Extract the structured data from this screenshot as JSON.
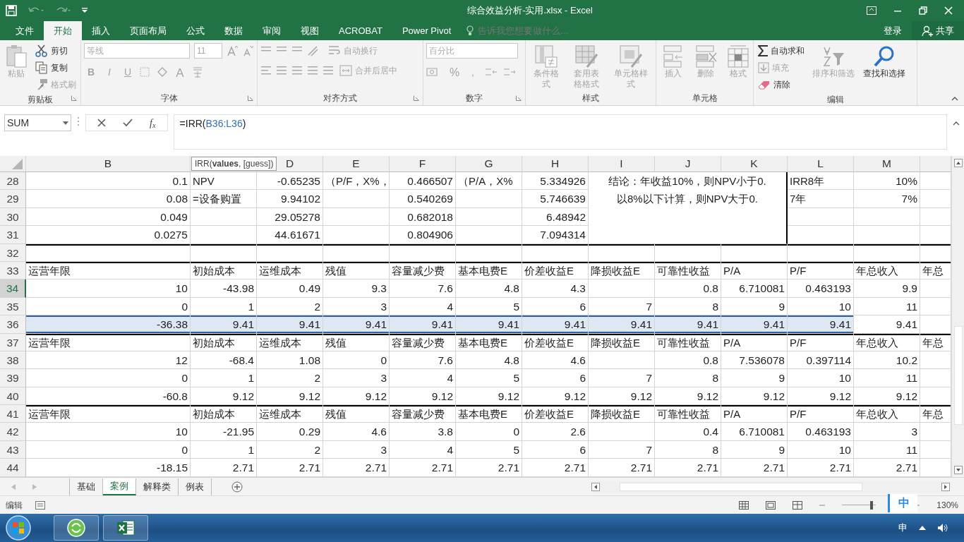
{
  "window": {
    "title": "综合效益分析-实用.xlsx - Excel"
  },
  "ribbon_tabs": [
    {
      "label": "文件",
      "selected": false
    },
    {
      "label": "开始",
      "selected": true
    },
    {
      "label": "插入",
      "selected": false
    },
    {
      "label": "页面布局",
      "selected": false
    },
    {
      "label": "公式",
      "selected": false
    },
    {
      "label": "数据",
      "selected": false
    },
    {
      "label": "审阅",
      "selected": false
    },
    {
      "label": "视图",
      "selected": false
    },
    {
      "label": "ACROBAT",
      "selected": false
    },
    {
      "label": "Power Pivot",
      "selected": false
    }
  ],
  "tell_me": {
    "placeholder": "告诉我您想要做什么..."
  },
  "account": {
    "sign_in": "登录",
    "share": "共享"
  },
  "ribbon_groups": [
    {
      "label": "剪贴板",
      "items": [
        {
          "kind": "large",
          "label": "粘贴",
          "disabled": true
        },
        {
          "kind": "small",
          "label": "剪切",
          "disabled": false
        },
        {
          "kind": "small",
          "label": "复制",
          "disabled": false
        },
        {
          "kind": "small",
          "label": "格式刷",
          "disabled": true
        }
      ]
    },
    {
      "label": "字体",
      "items": [
        {
          "kind": "field",
          "value": "等线",
          "disabled": true
        },
        {
          "kind": "field",
          "value": "11",
          "disabled": true
        },
        {
          "kind": "glyph",
          "label": "B",
          "disabled": true
        },
        {
          "kind": "glyph",
          "label": "I",
          "disabled": true
        },
        {
          "kind": "glyph",
          "label": "U",
          "disabled": true
        },
        {
          "kind": "glyph",
          "label": "A",
          "disabled": true
        }
      ]
    },
    {
      "label": "对齐方式",
      "items": [
        {
          "kind": "small",
          "label": "自动换行",
          "disabled": true
        },
        {
          "kind": "small",
          "label": "合并后居中",
          "disabled": true
        }
      ]
    },
    {
      "label": "数字",
      "items": [
        {
          "kind": "field",
          "value": "百分比",
          "disabled": true
        },
        {
          "kind": "glyph",
          "label": "%",
          "disabled": true
        },
        {
          "kind": "glyph",
          "label": ",",
          "disabled": true
        }
      ]
    },
    {
      "label": "样式",
      "items": [
        {
          "kind": "large",
          "label": "条件格式",
          "disabled": true
        },
        {
          "kind": "large",
          "label": "套用表格格式",
          "disabled": true
        },
        {
          "kind": "large",
          "label": "单元格样式",
          "disabled": true
        }
      ]
    },
    {
      "label": "单元格",
      "items": [
        {
          "kind": "large",
          "label": "插入",
          "disabled": true
        },
        {
          "kind": "large",
          "label": "删除",
          "disabled": true
        },
        {
          "kind": "large",
          "label": "格式",
          "disabled": true
        }
      ]
    },
    {
      "label": "编辑",
      "items": [
        {
          "kind": "small",
          "label": "自动求和",
          "disabled": false
        },
        {
          "kind": "small",
          "label": "填充",
          "disabled": true
        },
        {
          "kind": "small",
          "label": "清除",
          "disabled": false
        },
        {
          "kind": "large",
          "label": "排序和筛选",
          "disabled": true
        },
        {
          "kind": "large",
          "label": "查找和选择",
          "disabled": false
        }
      ]
    }
  ],
  "formula_bar": {
    "name_box": "SUM",
    "insert_function": "f$_{x}$",
    "formula": [
      {
        "kind": "plain",
        "text": "=IRR("
      },
      {
        "kind": "ref",
        "text": "B36:L36"
      },
      {
        "kind": "plain",
        "text": ")"
      }
    ],
    "tooltip": "IRR(**values**, [guess])"
  },
  "column_headers": [
    "B",
    "D",
    "E",
    "F",
    "G",
    "H",
    "I",
    "J",
    "K",
    "L",
    "M"
  ],
  "note": {
    "lines": [
      "结论：年收益10%，则NPV小于0.",
      "以8%以下计算，则NPV大于0."
    ]
  },
  "rows": [
    {
      "num": "28",
      "active": false,
      "in_range": false,
      "rule_above": false,
      "cells": [
        "0.1",
        "NPV",
        "-0.65235",
        "（P/F，X%，",
        "0.466507",
        "（P/A，X%",
        "5.334926",
        null,
        null,
        null,
        "IRR8年",
        "10%",
        null
      ]
    },
    {
      "num": "29",
      "active": false,
      "in_range": false,
      "rule_above": false,
      "cells": [
        "0.08",
        "=设备购置",
        "9.94102",
        null,
        "0.540269",
        null,
        "5.746639",
        null,
        null,
        null,
        "7年",
        "7%",
        null
      ]
    },
    {
      "num": "30",
      "active": false,
      "in_range": false,
      "rule_above": false,
      "cells": [
        "0.049",
        null,
        "29.05278",
        null,
        "0.682018",
        null,
        "6.48942",
        null,
        null,
        null,
        null,
        null,
        null
      ]
    },
    {
      "num": "31",
      "active": false,
      "in_range": false,
      "rule_above": false,
      "cells": [
        "0.0275",
        null,
        "44.61671",
        null,
        "0.804906",
        null,
        "7.094314",
        null,
        null,
        null,
        null,
        null,
        null
      ]
    },
    {
      "num": "32",
      "active": false,
      "in_range": false,
      "rule_above": true,
      "cells": [
        null,
        null,
        null,
        null,
        null,
        null,
        null,
        null,
        null,
        null,
        null,
        null,
        null
      ]
    },
    {
      "num": "33",
      "active": false,
      "in_range": false,
      "rule_above": true,
      "cells": [
        "运营年限",
        "初始成本",
        "运维成本",
        "残值",
        "容量减少费",
        "基本电费E",
        "价差收益E",
        "降损收益E",
        "可靠性收益",
        "P/A",
        "P/F",
        "年总收入",
        "年总"
      ]
    },
    {
      "num": "34",
      "active": true,
      "in_range": false,
      "rule_above": false,
      "cells": [
        "10",
        "-43.98",
        "0.49",
        "9.3",
        "7.6",
        "4.8",
        "4.3",
        null,
        "0.8",
        "6.710081",
        "0.463193",
        "9.9",
        null
      ]
    },
    {
      "num": "35",
      "active": false,
      "in_range": false,
      "rule_above": false,
      "cells": [
        "0",
        "1",
        "2",
        "3",
        "4",
        "5",
        "6",
        "7",
        "8",
        "9",
        "10",
        "11",
        null
      ]
    },
    {
      "num": "36",
      "active": false,
      "in_range": true,
      "rule_above": false,
      "cells": [
        "-36.38",
        "9.41",
        "9.41",
        "9.41",
        "9.41",
        "9.41",
        "9.41",
        "9.41",
        "9.41",
        "9.41",
        "9.41",
        "9.41",
        null
      ]
    },
    {
      "num": "37",
      "active": false,
      "in_range": false,
      "rule_above": true,
      "cells": [
        "运营年限",
        "初始成本",
        "运维成本",
        "残值",
        "容量减少费",
        "基本电费E",
        "价差收益E",
        "降损收益E",
        "可靠性收益",
        "P/A",
        "P/F",
        "年总收入",
        "年总"
      ]
    },
    {
      "num": "38",
      "active": false,
      "in_range": false,
      "rule_above": false,
      "cells": [
        "12",
        "-68.4",
        "1.08",
        "0",
        "7.6",
        "4.8",
        "4.6",
        null,
        "0.8",
        "7.536078",
        "0.397114",
        "10.2",
        null
      ]
    },
    {
      "num": "39",
      "active": false,
      "in_range": false,
      "rule_above": false,
      "cells": [
        "0",
        "1",
        "2",
        "3",
        "4",
        "5",
        "6",
        "7",
        "8",
        "9",
        "10",
        "11",
        null
      ]
    },
    {
      "num": "40",
      "active": false,
      "in_range": false,
      "rule_above": false,
      "cells": [
        "-60.8",
        "9.12",
        "9.12",
        "9.12",
        "9.12",
        "9.12",
        "9.12",
        "9.12",
        "9.12",
        "9.12",
        "9.12",
        "9.12",
        null
      ]
    },
    {
      "num": "41",
      "active": false,
      "in_range": false,
      "rule_above": true,
      "cells": [
        "运营年限",
        "初始成本",
        "运维成本",
        "残值",
        "容量减少费",
        "基本电费E",
        "价差收益E",
        "降损收益E",
        "可靠性收益",
        "P/A",
        "P/F",
        "年总收入",
        "年总"
      ]
    },
    {
      "num": "42",
      "active": false,
      "in_range": false,
      "rule_above": false,
      "cells": [
        "10",
        "-21.95",
        "0.29",
        "4.6",
        "3.8",
        "0",
        "2.6",
        null,
        "0.4",
        "6.710081",
        "0.463193",
        "3",
        null
      ]
    },
    {
      "num": "43",
      "active": false,
      "in_range": false,
      "rule_above": false,
      "cells": [
        "0",
        "1",
        "2",
        "3",
        "4",
        "5",
        "6",
        "7",
        "8",
        "9",
        "10",
        "11",
        null
      ]
    },
    {
      "num": "44",
      "active": false,
      "in_range": false,
      "rule_above": false,
      "cells": [
        "-18.15",
        "2.71",
        "2.71",
        "2.71",
        "2.71",
        "2.71",
        "2.71",
        "2.71",
        "2.71",
        "2.71",
        "2.71",
        "2.71",
        null
      ]
    }
  ],
  "sheet_tabs": [
    {
      "label": "基础",
      "selected": false
    },
    {
      "label": "案例",
      "selected": true
    },
    {
      "label": "解释类",
      "selected": false
    },
    {
      "label": "例表",
      "selected": false
    }
  ],
  "status_bar": {
    "mode": "编辑",
    "zoom": "130%",
    "zoom_slider": {
      "level": 0.9
    }
  },
  "ime_bar": {
    "label": "中"
  },
  "taskbar": {
    "ime": "申"
  }
}
